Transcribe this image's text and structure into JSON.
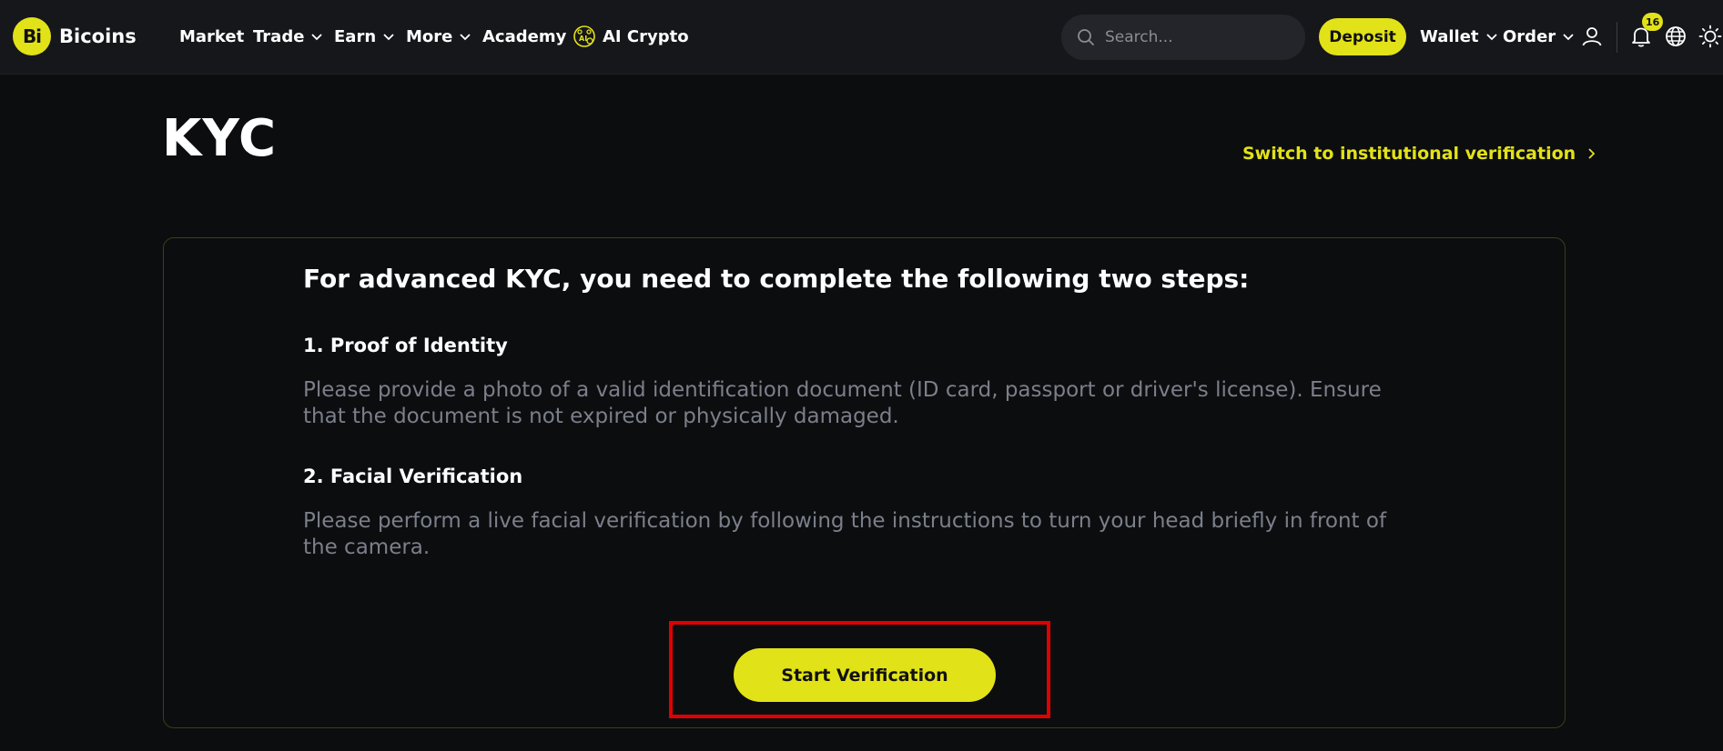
{
  "brand": {
    "name": "Bicoins",
    "logo_text": "Bi"
  },
  "nav": {
    "market": "Market",
    "trade": "Trade",
    "earn": "Earn",
    "more": "More",
    "academy": "Academy",
    "ai_crypto": "AI Crypto"
  },
  "search": {
    "placeholder": "Search..."
  },
  "header": {
    "deposit": "Deposit",
    "wallet": "Wallet",
    "order": "Order",
    "notification_count": "16"
  },
  "page": {
    "title": "KYC",
    "switch_link": "Switch to institutional verification"
  },
  "card": {
    "heading": "For advanced KYC, you need to complete the following two steps:",
    "steps": [
      {
        "title": "1. Proof of Identity",
        "description": "Please provide a photo of a valid identification document (ID card, passport or driver's license). Ensure that the document is not expired or physically damaged."
      },
      {
        "title": "2. Facial Verification",
        "description": "Please perform a live facial verification by following the instructions to turn your head briefly in front of the camera."
      }
    ],
    "start_button": "Start Verification"
  },
  "colors": {
    "accent": "#e2e218",
    "background": "#0c0d0f",
    "navbar": "#16171b",
    "muted_text": "#7b7f8a",
    "highlight": "#e00000"
  },
  "icons": {
    "search": "search-icon",
    "user": "user-icon",
    "bell": "bell-icon",
    "globe": "globe-icon",
    "theme": "sun-icon",
    "ai": "ai-brain-icon"
  }
}
